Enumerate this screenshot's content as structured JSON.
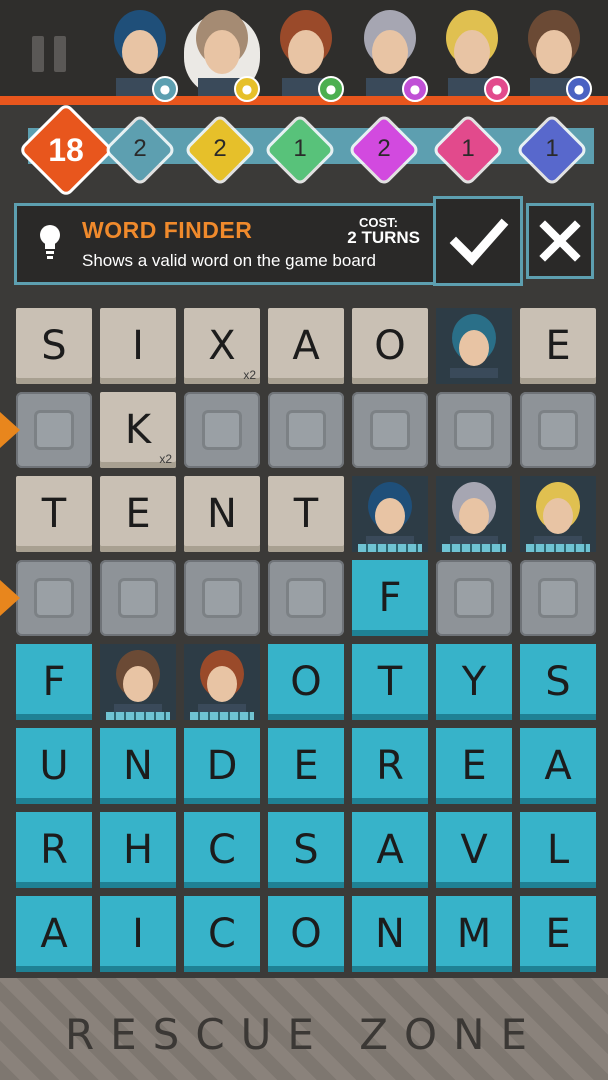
{
  "header": {
    "characters": [
      {
        "name": "blue-hair-boy",
        "power_icon": "lightbulb-icon",
        "power_color": "#5d9fb0"
      },
      {
        "name": "monkey",
        "power_icon": "coin-icon",
        "power_color": "#e6c02a"
      },
      {
        "name": "red-hair-girl",
        "power_icon": "phone-icon",
        "power_color": "#4caf50"
      },
      {
        "name": "robot",
        "power_icon": "swap-icon",
        "power_color": "#c050d6"
      },
      {
        "name": "blonde-girl",
        "power_icon": "hammer-icon",
        "power_color": "#e24a8c"
      },
      {
        "name": "old-man",
        "power_icon": "wrench-icon",
        "power_color": "#4a62c2"
      }
    ]
  },
  "counters": [
    {
      "value": "18",
      "color": "#e8561d"
    },
    {
      "value": "2",
      "color": "#5d9fb0"
    },
    {
      "value": "2",
      "color": "#e6c02a"
    },
    {
      "value": "1",
      "color": "#58c27a"
    },
    {
      "value": "2",
      "color": "#d24adf"
    },
    {
      "value": "1",
      "color": "#e24a8c"
    },
    {
      "value": "1",
      "color": "#5868cc"
    }
  ],
  "power_info": {
    "title": "WORD FINDER",
    "description": "Shows a valid word on the game board",
    "cost_label": "COST:",
    "cost_value": "2 TURNS"
  },
  "board": [
    [
      {
        "t": "stone",
        "l": "S"
      },
      {
        "t": "stone",
        "l": "I"
      },
      {
        "t": "stone",
        "l": "X",
        "m": "x2"
      },
      {
        "t": "stone",
        "l": "A"
      },
      {
        "t": "stone",
        "l": "O"
      },
      {
        "t": "char",
        "c": "robot-pod"
      },
      {
        "t": "stone",
        "l": "E"
      }
    ],
    [
      {
        "t": "slot"
      },
      {
        "t": "stone",
        "l": "K",
        "m": "x2"
      },
      {
        "t": "slot"
      },
      {
        "t": "slot"
      },
      {
        "t": "slot"
      },
      {
        "t": "slot"
      },
      {
        "t": "slot"
      }
    ],
    [
      {
        "t": "stone",
        "l": "T"
      },
      {
        "t": "stone",
        "l": "E"
      },
      {
        "t": "stone",
        "l": "N"
      },
      {
        "t": "stone",
        "l": "T"
      },
      {
        "t": "char",
        "c": "blue-hair-boy"
      },
      {
        "t": "char",
        "c": "robot"
      },
      {
        "t": "char",
        "c": "blonde-girl"
      }
    ],
    [
      {
        "t": "slot"
      },
      {
        "t": "slot"
      },
      {
        "t": "slot"
      },
      {
        "t": "slot"
      },
      {
        "t": "water",
        "l": "F"
      },
      {
        "t": "slot"
      },
      {
        "t": "slot"
      }
    ],
    [
      {
        "t": "water",
        "l": "F"
      },
      {
        "t": "char",
        "c": "old-man"
      },
      {
        "t": "char",
        "c": "red-hair-girl"
      },
      {
        "t": "water",
        "l": "O"
      },
      {
        "t": "water",
        "l": "T"
      },
      {
        "t": "water",
        "l": "Y"
      },
      {
        "t": "water",
        "l": "S"
      }
    ],
    [
      {
        "t": "water",
        "l": "U"
      },
      {
        "t": "water",
        "l": "N"
      },
      {
        "t": "water",
        "l": "D"
      },
      {
        "t": "water",
        "l": "E"
      },
      {
        "t": "water",
        "l": "R"
      },
      {
        "t": "water",
        "l": "E"
      },
      {
        "t": "water",
        "l": "A"
      }
    ],
    [
      {
        "t": "water",
        "l": "R"
      },
      {
        "t": "water",
        "l": "H"
      },
      {
        "t": "water",
        "l": "C"
      },
      {
        "t": "water",
        "l": "S"
      },
      {
        "t": "water",
        "l": "A"
      },
      {
        "t": "water",
        "l": "V"
      },
      {
        "t": "water",
        "l": "L"
      }
    ],
    [
      {
        "t": "water",
        "l": "A"
      },
      {
        "t": "water",
        "l": "I"
      },
      {
        "t": "water",
        "l": "C"
      },
      {
        "t": "water",
        "l": "O"
      },
      {
        "t": "water",
        "l": "N"
      },
      {
        "t": "water",
        "l": "M"
      },
      {
        "t": "water",
        "l": "E"
      }
    ]
  ],
  "row_markers": [
    1,
    3
  ],
  "footer": {
    "label": "RESCUE ZONE"
  }
}
